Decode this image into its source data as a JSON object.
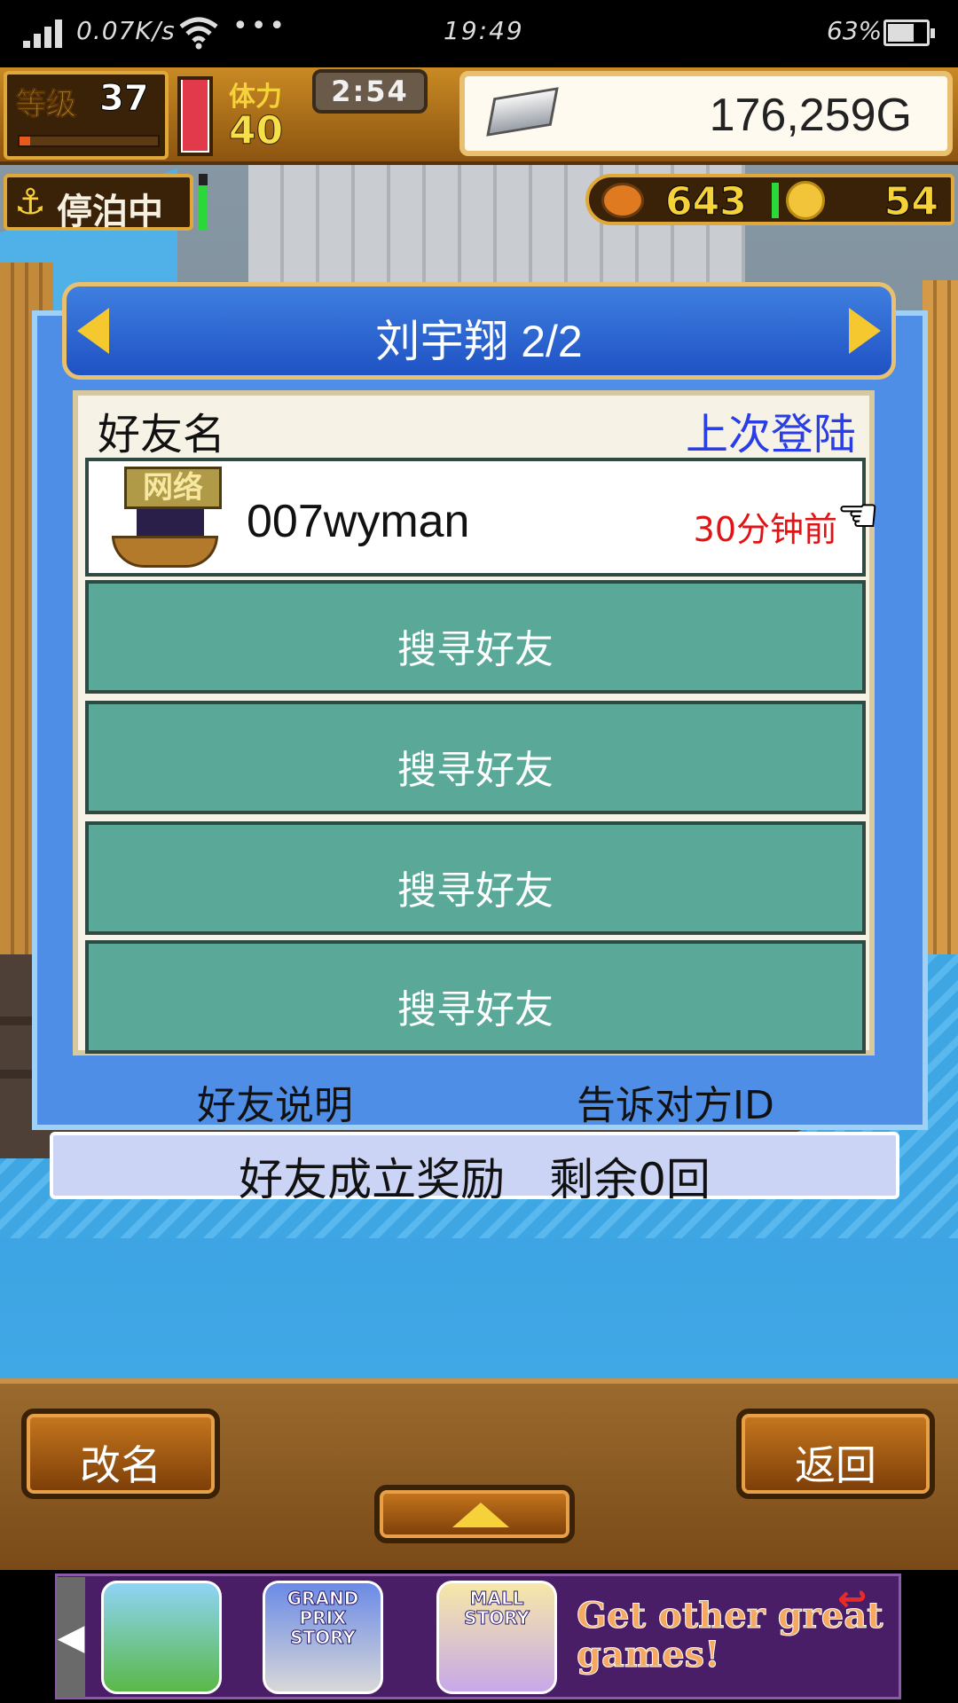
{
  "status_bar": {
    "network_speed": "0.07K/s",
    "more": "•••",
    "time": "19:49",
    "battery_percent": "63%",
    "battery_level": 0.63,
    "icons": [
      "signal-icon",
      "wifi-icon",
      "battery-icon"
    ]
  },
  "hud": {
    "level_label": "等级",
    "level_value": "37",
    "level_progress": 0.08,
    "stamina_gauge_level": 1.0,
    "stamina_label": "体力",
    "stamina_value": "40",
    "timer": "2:54",
    "gold": "176,259G",
    "status_label": "停泊中",
    "food": "643",
    "medals": "54"
  },
  "dialog": {
    "title": "刘宇翔 2/2",
    "columns": {
      "name": "好友名",
      "last_login": "上次登陆"
    },
    "friends": [
      {
        "badge": "网络",
        "name": "007wyman",
        "last_login": "30分钟前"
      }
    ],
    "empty_slots": [
      "搜寻好友",
      "搜寻好友",
      "搜寻好友",
      "搜寻好友"
    ],
    "links": {
      "friend_help": "好友说明",
      "tell_id": "告诉对方ID"
    },
    "reward": "好友成立奖励　剩余0回"
  },
  "toolbar": {
    "rename_label": "改名",
    "back_label": "返回"
  },
  "ad": {
    "games": [
      "",
      "GRAND PRIX STORY",
      "MALL STORY"
    ],
    "cta": "Get other great games!"
  },
  "colors": {
    "dialog_blue": "#4f8ee6",
    "slot_green": "#5aa898",
    "login_blue": "#2a3ee6",
    "time_red": "#e01414",
    "wood": "#9a6a2e"
  }
}
